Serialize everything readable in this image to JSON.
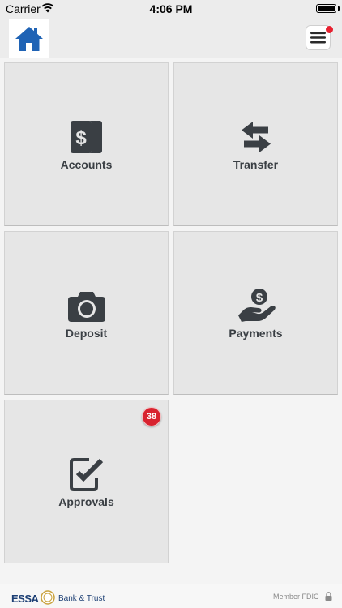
{
  "status_bar": {
    "carrier": "Carrier",
    "time": "4:06 PM"
  },
  "header": {
    "home_icon": "home-icon",
    "menu_icon": "hamburger-menu-icon",
    "notification_dot_color": "#e8202f"
  },
  "tiles": [
    {
      "label": "Accounts",
      "icon": "dollar-cards-icon"
    },
    {
      "label": "Transfer",
      "icon": "transfer-arrows-icon"
    },
    {
      "label": "Deposit",
      "icon": "camera-icon"
    },
    {
      "label": "Payments",
      "icon": "hand-coin-icon"
    },
    {
      "label": "Approvals",
      "icon": "checkbox-icon",
      "badge": "38"
    }
  ],
  "footer": {
    "logo_text": "ESSA",
    "logo_subtext": "Bank & Trust",
    "fdic_text": "Member FDIC"
  },
  "colors": {
    "brand_blue": "#1f63b5",
    "icon_dark": "#3a3f44",
    "badge_red": "#d8232f"
  }
}
